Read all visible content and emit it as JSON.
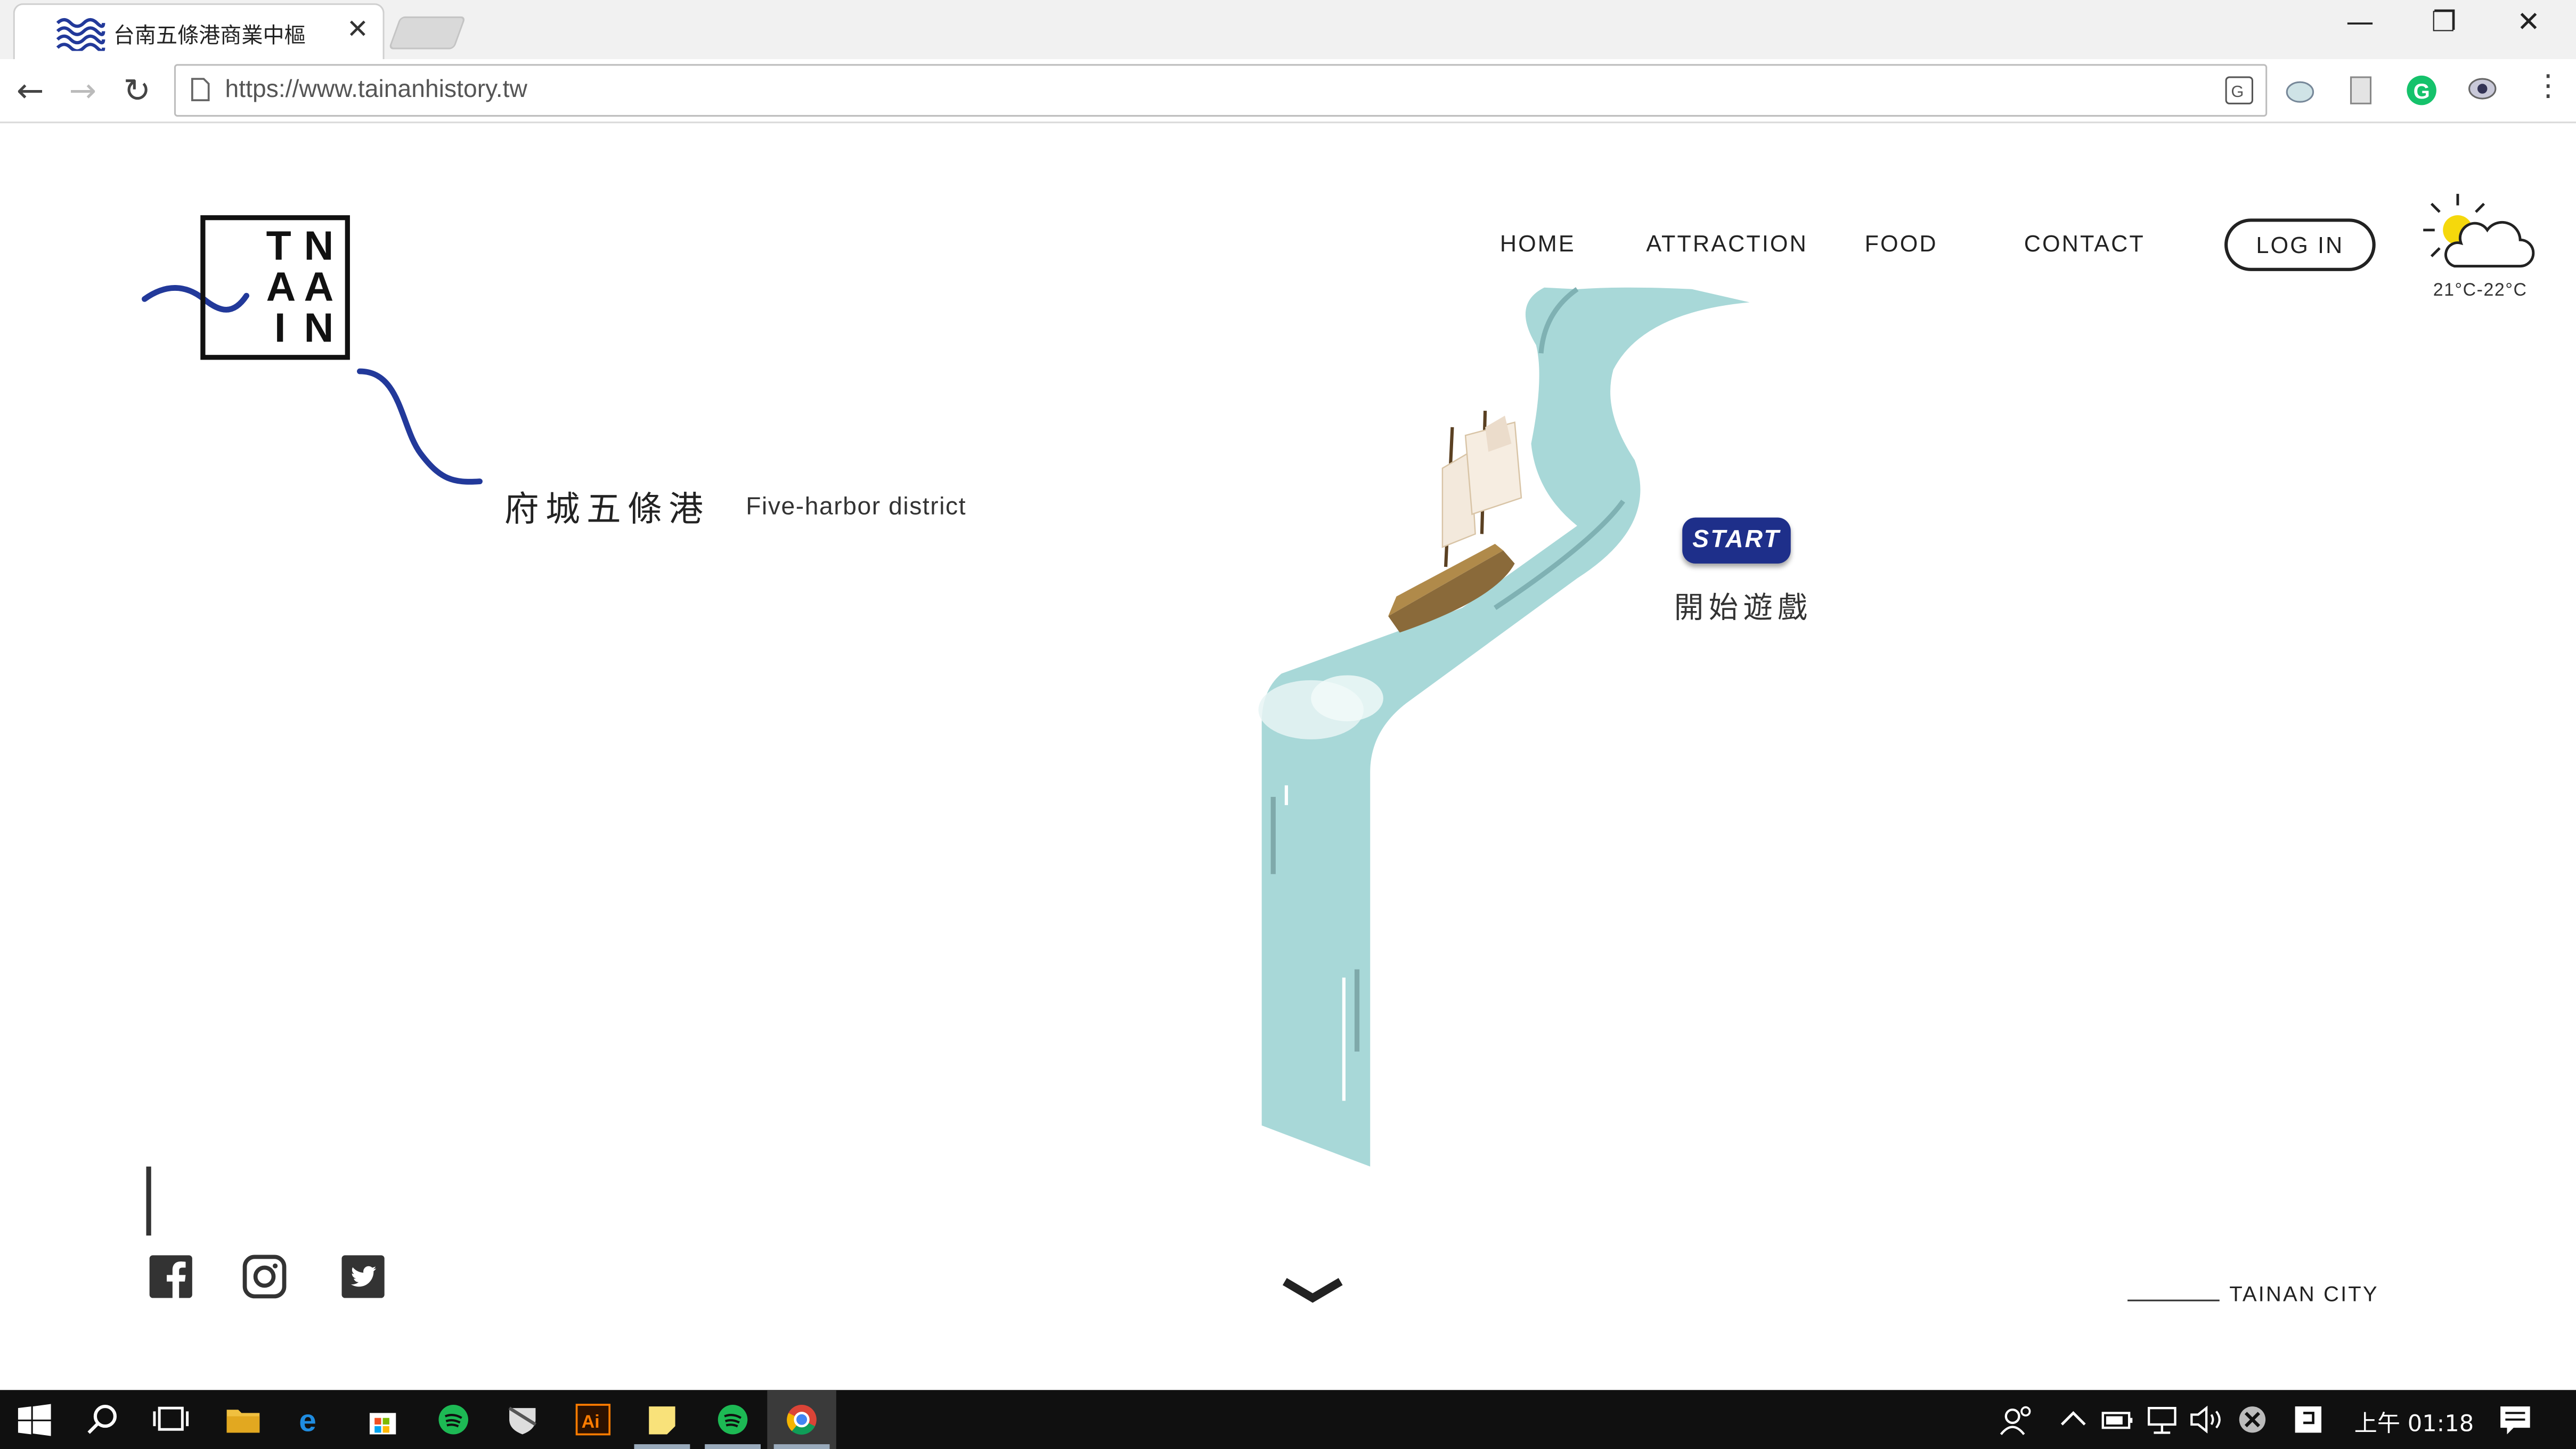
{
  "browser": {
    "tab_title": "台南五條港商業中樞",
    "url": "https://www.tainanhistory.tw"
  },
  "site": {
    "logo_letters": [
      "T",
      "N",
      "A",
      "A",
      "I",
      "N"
    ],
    "nav": [
      "HOME",
      "ATTRACTION",
      "FOOD",
      "CONTACT"
    ],
    "login_label": "LOG IN",
    "weather": {
      "icon": "partly-cloudy-icon",
      "temp": "21°C-22°C"
    },
    "district_zh": "府城五條港",
    "district_en": "Five-harbor district",
    "start_label": "START",
    "start_zh": "開始遊戲",
    "social": [
      "facebook-icon",
      "instagram-icon",
      "twitter-icon"
    ],
    "city_label": "TAINAN CITY"
  },
  "taskbar": {
    "clock": "上午 01:18"
  },
  "colors": {
    "brand_blue": "#22399a",
    "start_button": "#1e2f8a",
    "river": "#a8d8d8",
    "text_dark": "#222222"
  }
}
